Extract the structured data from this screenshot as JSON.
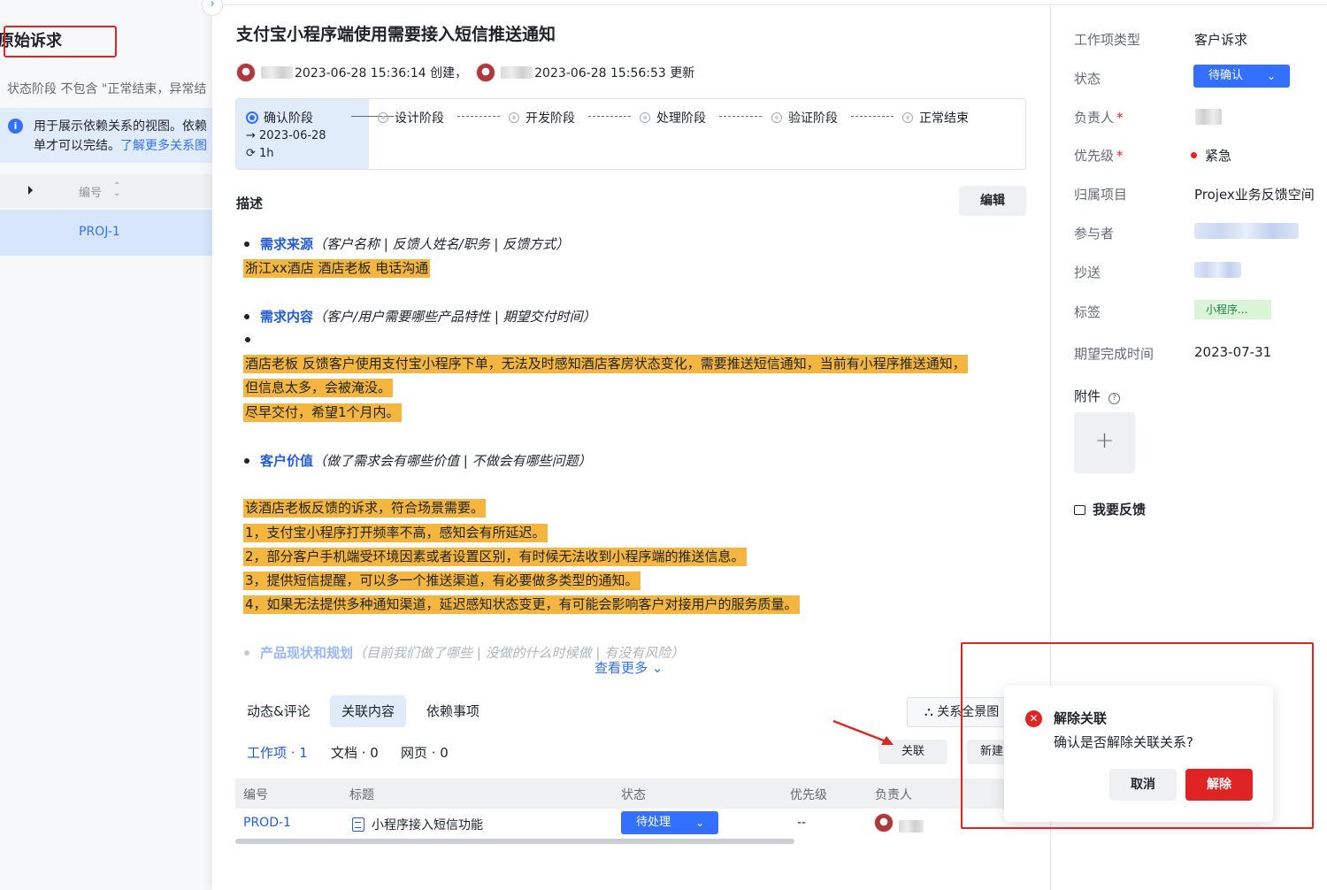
{
  "left": {
    "title": "原始诉求",
    "subtitle": "状态阶段 不包含 \"正常结束，异常结",
    "info_line1": "用于展示依赖关系的视图。依赖",
    "info_line2_text": "单才可以完结。",
    "info_line2_link": "了解更多关系图",
    "table_header": "编号",
    "row_id": "PROJ-1"
  },
  "header": {
    "title": "支付宝小程序端使用需要接入短信推送通知",
    "created": "2023-06-28 15:36:14 创建，",
    "updated": "2023-06-28 15:56:53 更新"
  },
  "stages": {
    "active": {
      "name": "确认阶段",
      "date": "→ 2023-06-28",
      "duration": "1h"
    },
    "others": [
      "设计阶段",
      "开发阶段",
      "处理阶段",
      "验证阶段",
      "正常结束"
    ]
  },
  "description": {
    "label": "描述",
    "edit_label": "编辑",
    "s1_key": "需求来源",
    "s1_hint": "（客户名称 | 反馈人姓名/职务 | 反馈方式）",
    "s1_hl": "浙江xx酒店   酒店老板  电话沟通",
    "s2_key": "需求内容",
    "s2_hint": "（客户/用户需要哪些产品特性 | 期望交付时间）",
    "s2_hl1": "酒店老板 反馈客户使用支付宝小程序下单，无法及时感知酒店客房状态变化，需要推送短信通知，当前有小程序推送通知，",
    "s2_hl2": "但信息太多，会被淹没。",
    "s2_hl3": "尽早交付，希望1个月内。",
    "s3_key": "客户价值",
    "s3_hint": "（做了需求会有哪些价值 | 不做会有哪些问题）",
    "s3_hl1": "该酒店老板反馈的诉求，符合场景需要。",
    "s3_hl2": "1，支付宝小程序打开频率不高，感知会有所延迟。",
    "s3_hl3": "2，部分客户手机端受环境因素或者设置区别，有时候无法收到小程序端的推送信息。",
    "s3_hl4": "3，提供短信提醒，可以多一个推送渠道，有必要做多类型的通知。",
    "s3_hl5": "4，如果无法提供多种通知渠道，延迟感知状态变更，有可能会影响客户对接用户的服务质量。",
    "s4_key": "产品现状和规划",
    "s4_hint": "（目前我们做了哪些 | 没做的什么时候做 | 有没有风险）",
    "see_more": "查看更多"
  },
  "tabs": [
    "动态&评论",
    "关联内容",
    "依赖事项"
  ],
  "relation_graph_label": "关系全景图",
  "subtabs": [
    "工作项 · 1",
    "文档 · 0",
    "网页 · 0"
  ],
  "link_label": "关联",
  "new_label": "新建",
  "table": {
    "columns": [
      "编号",
      "标题",
      "状态",
      "优先级",
      "负责人"
    ],
    "row": {
      "id": "PROD-1",
      "title": "小程序接入短信功能",
      "status": "待处理",
      "priority": "--"
    }
  },
  "props": {
    "type_label": "工作项类型",
    "type_value": "客户诉求",
    "status_label": "状态",
    "status_value": "待确认",
    "owner_label": "负责人",
    "priority_label": "优先级",
    "priority_value": "紧急",
    "project_label": "归属项目",
    "project_value": "Projex业务反馈空间",
    "participants_label": "参与者",
    "cc_label": "抄送",
    "tags_label": "标签",
    "tag_value": "小程序...",
    "due_label": "期望完成时间",
    "due_value": "2023-07-31",
    "attach_label": "附件",
    "feedback_label": "我要反馈",
    "required_mark": "*"
  },
  "popconfirm": {
    "title": "解除关联",
    "message": "确认是否解除关联关系?",
    "cancel": "取消",
    "confirm": "解除"
  },
  "colors": {
    "accent": "#3370ff",
    "danger": "#e02424",
    "highlight": "#f5b640"
  }
}
